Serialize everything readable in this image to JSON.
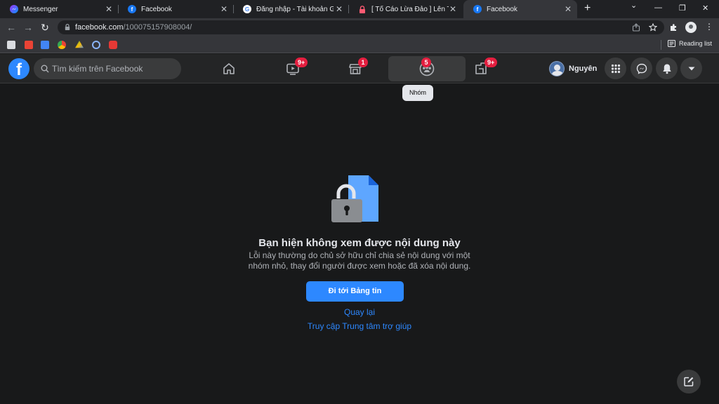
{
  "browser": {
    "tabs": [
      {
        "title": "Messenger",
        "active": false
      },
      {
        "title": "Facebook",
        "active": false
      },
      {
        "title": "Đăng nhập - Tài khoản Goog",
        "active": false
      },
      {
        "title": "[ Tố Cáo Lừa Đảo ] Lên Trung",
        "active": false
      },
      {
        "title": "Facebook",
        "active": true
      }
    ],
    "new_tab": "+",
    "window_controls": {
      "dropdown": "⌄",
      "minimize": "—",
      "restore": "❐",
      "close": "✕"
    },
    "nav": {
      "back": "←",
      "forward": "→",
      "reload": "↻"
    },
    "address": {
      "host": "facebook.com",
      "path": "/100075157908004/"
    },
    "reading_list": "Reading list"
  },
  "facebook": {
    "logo": "f",
    "search_placeholder": "Tìm kiếm trên Facebook",
    "nav_badges": {
      "watch": "9+",
      "marketplace": "1",
      "groups": "5",
      "gaming": "9+"
    },
    "tooltip": "Nhóm",
    "profile_name": "Nguyên"
  },
  "main": {
    "title": "Bạn hiện không xem được nội dung này",
    "message_line1": "Lỗi này thường do chủ sở hữu chỉ chia sẻ nội dung với một",
    "message_line2": "nhóm nhỏ, thay đổi người được xem hoặc đã xóa nội dung.",
    "primary_button": "Đi tới Bảng tin",
    "back_link": "Quay lại",
    "help_link": "Truy cập Trung tâm trợ giúp"
  },
  "colors": {
    "accent": "#2d88ff",
    "badge": "#e41e3f",
    "background": "#18191a",
    "header": "#242526"
  }
}
